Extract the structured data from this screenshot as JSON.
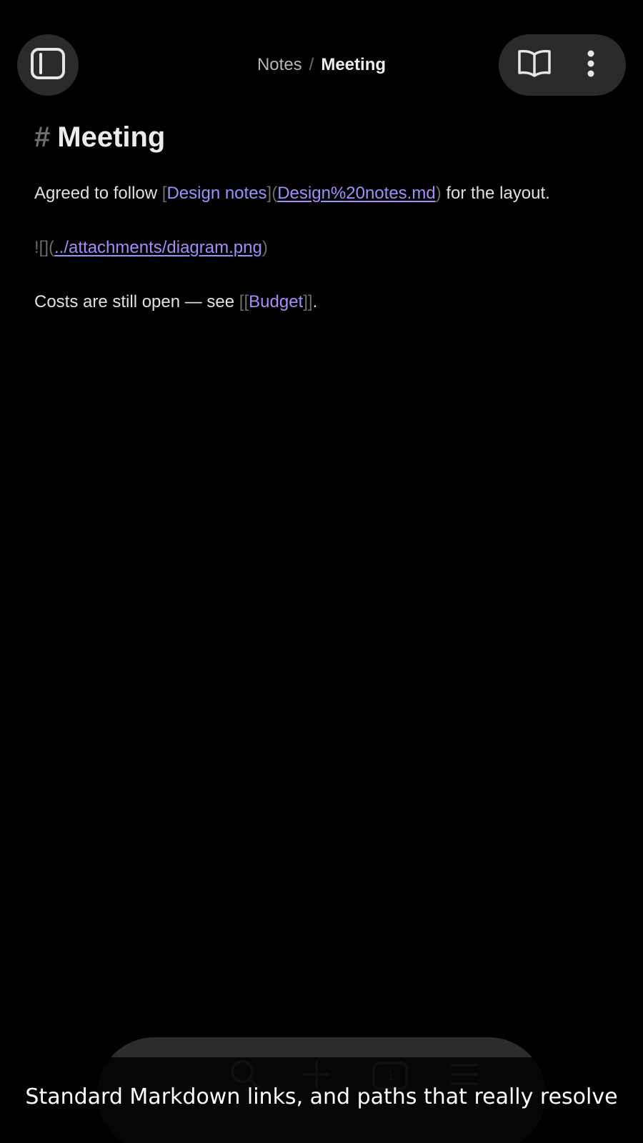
{
  "topbar": {
    "left_button_icon": "sidebar-toggle-icon",
    "right_icons": [
      "reading-mode-icon",
      "more-options-icon"
    ]
  },
  "breadcrumb": {
    "parent": "Notes",
    "separator": "/",
    "current": "Meeting"
  },
  "document": {
    "heading_marker": "#",
    "heading": "Meeting",
    "para1": {
      "prefix": "Agreed to follow ",
      "link_open": "[",
      "link_text": "Design notes",
      "link_mid": "](",
      "link_url": "Design%20notes.md",
      "link_close": ")",
      "suffix": " for the layout."
    },
    "para2": {
      "prefix": "![](",
      "link_url": "../attachments/diagram.png",
      "link_close": ")"
    },
    "para3": {
      "prefix": "Costs are still open — see ",
      "wiki_open": "[[",
      "wiki_text": "Budget",
      "wiki_close": "]]",
      "suffix": "."
    }
  },
  "bottom_toolbar": {
    "icons": [
      "search-icon",
      "add-icon",
      "tabs-icon",
      "menu-icon"
    ],
    "tab_count": "1"
  },
  "caption": "Standard Markdown links, and paths that really resolve",
  "colors": {
    "background": "#000000",
    "accent_link": "#a78bfa",
    "syntax_muted": "#6b6b6b",
    "button_bg": "#2b2b2b"
  }
}
